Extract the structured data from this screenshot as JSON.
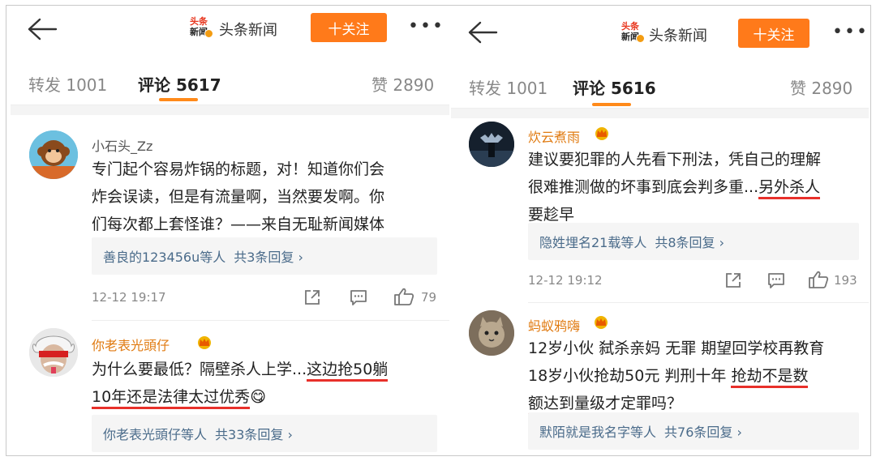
{
  "left": {
    "site_name": "头条新闻",
    "logo_top": "头条",
    "logo_bottom": "新闻",
    "follow_label": "十关注",
    "more": "•••",
    "tabs": {
      "forward": "转发 1001",
      "comments": "评论 5617",
      "likes": "赞 2890"
    },
    "comments": [
      {
        "user": "小石头_Zz",
        "lines": [
          "专门起个容易炸锅的标题，对！知道你们会",
          "炸会误读，但是有流量啊，当然要发啊。你",
          "们每次都上套怪谁？——来自无耻新闻媒体"
        ],
        "reply_users": "善良的123456u等人",
        "reply_count": "共3条回复 ›",
        "time": "12-12 19:17",
        "like_count": "79"
      },
      {
        "user": "你老表光頭仔",
        "line1_plain": "为什么要最低？隔壁杀人上学...",
        "line1_ul": "这边抢50躺",
        "line2_ul": "10年还是法律太过优秀",
        "line2_emoji": "😋",
        "reply_users": "你老表光頭仔等人",
        "reply_count": "共33条回复 ›"
      }
    ]
  },
  "right": {
    "site_name": "头条新闻",
    "logo_top": "头条",
    "logo_bottom": "新闻",
    "follow_label": "十关注",
    "more": "•••",
    "tabs": {
      "forward": "转发 1001",
      "comments": "评论 5616",
      "likes": "赞 2890"
    },
    "comments": [
      {
        "user": "炊云煮雨",
        "line1": "建议要犯罪的人先看下刑法，凭自己的理解",
        "line2_plain": "很难推测做的坏事到底会判多重...",
        "line2_ul": "另外杀人",
        "line3_ul": "要趁早",
        "reply_users": "隐姓埋名21载等人",
        "reply_count": "共8条回复 ›",
        "time": "12-12 19:12",
        "like_count": "193"
      },
      {
        "user": "蚂蚁鸦嗨",
        "line1": "12岁小伙 弑杀亲妈 无罪 期望回学校再教育",
        "line2_plain": "18岁小伙抢劫50元 判刑十年 ",
        "line2_ul": "抢劫不是数",
        "line3_ul": "额达到量级才定罪吗？",
        "reply_users": "默陌就是我名字等人",
        "reply_count": "共76条回复 ›"
      }
    ]
  }
}
